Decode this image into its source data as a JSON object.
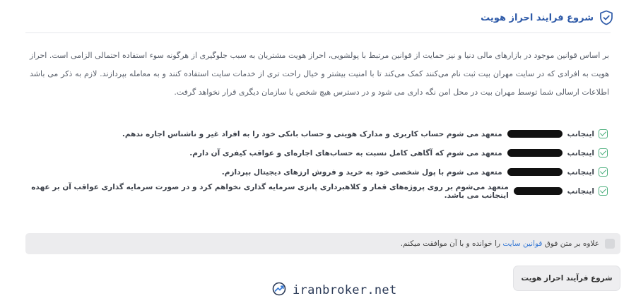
{
  "header": {
    "title": "شروع فرایند احراز هویت",
    "icon": "shield-check-icon",
    "accent": "#2e5aa8"
  },
  "intro": {
    "text": "بر اساس قوانین موجود در بازارهای مالی دنیا و نیز حمایت از قوانین مرتبط با پولشویی، احراز هویت مشتریان به سبب جلوگیری از هرگونه سوء استفاده احتمالی الزامی است. احراز هویت به افرادی که در سایت مهران بیت ثبت نام می‌کنند کمک می‌کند تا با امنیت بیشتر و خیال راحت تری از خدمات سایت استفاده کنند و به معامله بپردازند. لازم به ذکر می باشد اطلاعات ارسالی شما توسط مهران بیت در محل امن نگه داری می شود و در دسترس هیچ شخص یا سازمان دیگری قرار نخواهد گرفت."
  },
  "rules": [
    {
      "prefix": "اینجانب",
      "text": "متعهد می شوم حساب کاربری و مدارک هویتی و حساب بانکی خود را به افراد غیر و ناشناس اجاره ندهم."
    },
    {
      "prefix": "اینجانب",
      "text": "متعهد می شوم که آگاهی کامل نسبت به حساب‌های اجاره‌ای و عواقب کیفری آن دارم."
    },
    {
      "prefix": "اینجانب",
      "text": "متعهد می شوم با پول شخصی خود به خرید و فروش ارزهای دیجیتال بپردازم."
    },
    {
      "prefix": "اینجانب",
      "text": "متعهد می‌شوم بر روی پروژه‌های قمار و کلاهبرداری پانزی سرمایه گذاری نخواهم کرد و در صورت سرمایه گذاری عواقب آن بر عهده اینجانب می باشد."
    }
  ],
  "agree": {
    "before": "علاوه بر متن فوق",
    "link": "قوانین سایت",
    "after": "را خوانده و با آن موافقت میکنم."
  },
  "actions": {
    "start_label": "شروع فرآیند احراز هویت"
  },
  "brand": {
    "text": "iranbroker.net",
    "icon": "trend-up-icon"
  },
  "colors": {
    "check": "#4caf7d",
    "link": "#3a7bd5"
  }
}
